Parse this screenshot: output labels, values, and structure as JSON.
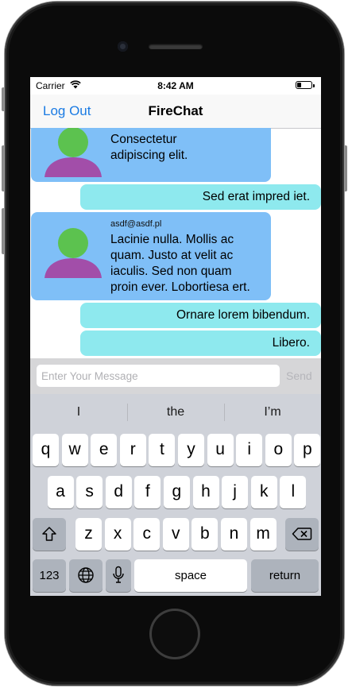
{
  "status_bar": {
    "carrier": "Carrier",
    "time": "8:42 AM",
    "battery": 0.3
  },
  "nav": {
    "left_button": "Log Out",
    "title": "FireChat"
  },
  "messages": [
    {
      "type": "incoming",
      "sender": "",
      "text": [
        "Consectetur",
        "adipiscing elit."
      ]
    },
    {
      "type": "outgoing",
      "text": "Sed erat impred iet."
    },
    {
      "type": "incoming",
      "sender": "asdf@asdf.pl",
      "text": [
        "Lacinie nulla. Mollis ac",
        "quam. Justo at velit ac",
        "iaculis. Sed non quam",
        "proin ever. Lobortiesa ert."
      ]
    },
    {
      "type": "outgoing",
      "text": "Ornare lorem bibendum."
    },
    {
      "type": "outgoing",
      "text": "Libero."
    }
  ],
  "composer": {
    "placeholder": "Enter Your Message",
    "value": "",
    "send_label": "Send"
  },
  "keyboard": {
    "suggestions": [
      "I",
      "the",
      "I’m"
    ],
    "row1": [
      "q",
      "w",
      "e",
      "r",
      "t",
      "y",
      "u",
      "i",
      "o",
      "p"
    ],
    "row2": [
      "a",
      "s",
      "d",
      "f",
      "g",
      "h",
      "j",
      "k",
      "l"
    ],
    "row3": [
      "z",
      "x",
      "c",
      "v",
      "b",
      "n",
      "m"
    ],
    "numbers_label": "123",
    "space_label": "space",
    "return_label": "return",
    "icons": {
      "shift": "shift-icon",
      "delete": "delete-icon",
      "globe": "globe-icon",
      "mic": "microphone-icon"
    }
  },
  "colors": {
    "incoming_bubble": "#7fbff7",
    "outgoing_bubble": "#8ee9ee",
    "accent": "#1b7be3",
    "avatar_head": "#5cc24f",
    "avatar_body": "#a24ea9"
  }
}
